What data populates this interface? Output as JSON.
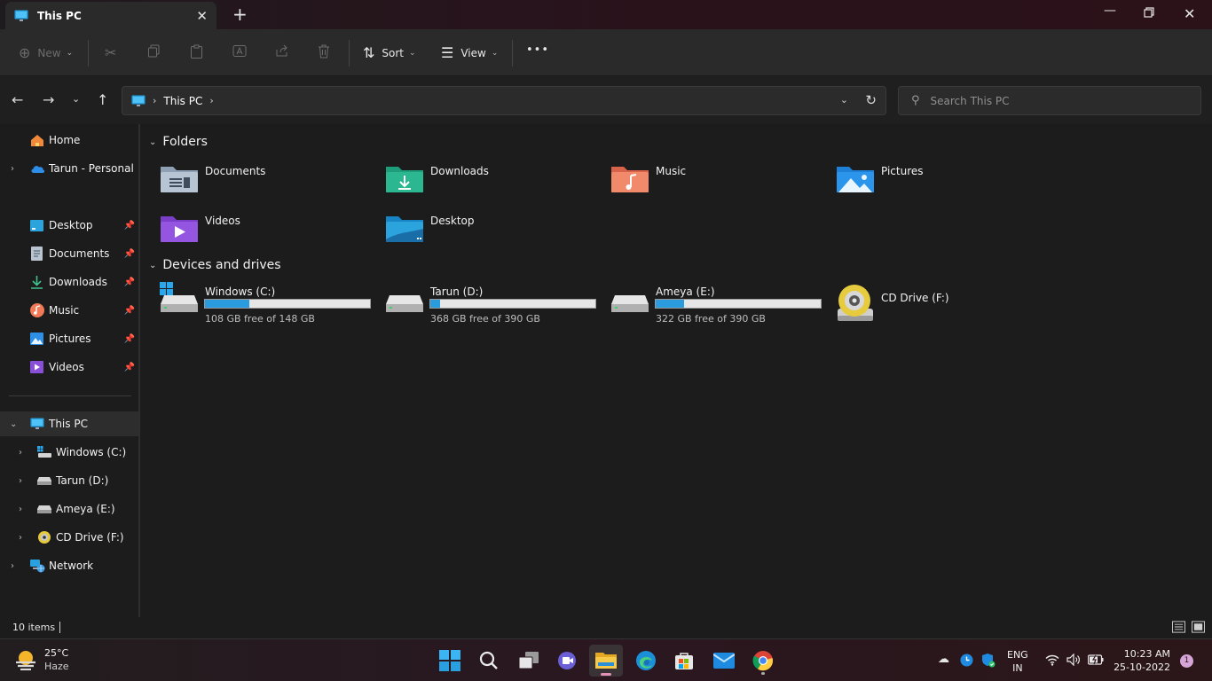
{
  "window": {
    "tab_title": "This PC",
    "colors": {
      "accent": "#2a9cde",
      "background": "#1c1c1c",
      "toolbar": "#2a2a2a"
    }
  },
  "toolbar": {
    "new_label": "New",
    "sort_label": "Sort",
    "view_label": "View",
    "more_label": "•••"
  },
  "address": {
    "crumbs": [
      "This PC"
    ],
    "search_placeholder": "Search This PC"
  },
  "sidebar": {
    "items": [
      {
        "label": "Home",
        "icon": "home-icon"
      },
      {
        "label": "Tarun - Personal",
        "icon": "onedrive-cloud-icon"
      },
      {
        "label": "Desktop",
        "icon": "desktop-icon",
        "pinned": true
      },
      {
        "label": "Documents",
        "icon": "documents-icon",
        "pinned": true
      },
      {
        "label": "Downloads",
        "icon": "downloads-icon",
        "pinned": true
      },
      {
        "label": "Music",
        "icon": "music-icon",
        "pinned": true
      },
      {
        "label": "Pictures",
        "icon": "pictures-icon",
        "pinned": true
      },
      {
        "label": "Videos",
        "icon": "videos-icon",
        "pinned": true
      },
      {
        "label": "This PC",
        "icon": "computer-icon",
        "selected": true
      },
      {
        "label": "Windows (C:)",
        "icon": "windows-drive-icon"
      },
      {
        "label": "Tarun (D:)",
        "icon": "hard-drive-icon"
      },
      {
        "label": "Ameya (E:)",
        "icon": "hard-drive-icon"
      },
      {
        "label": "CD Drive (F:)",
        "icon": "cd-drive-icon"
      },
      {
        "label": "Network",
        "icon": "network-icon"
      }
    ]
  },
  "main": {
    "folders_heading": "Folders",
    "folders": [
      {
        "name": "Documents",
        "icon": "documents-folder-icon"
      },
      {
        "name": "Downloads",
        "icon": "downloads-folder-icon"
      },
      {
        "name": "Music",
        "icon": "music-folder-icon"
      },
      {
        "name": "Pictures",
        "icon": "pictures-folder-icon"
      },
      {
        "name": "Videos",
        "icon": "videos-folder-icon"
      },
      {
        "name": "Desktop",
        "icon": "desktop-folder-icon"
      }
    ],
    "drives_heading": "Devices and drives",
    "drives": [
      {
        "name": "Windows (C:)",
        "free_text": "108 GB free of 148 GB",
        "used_fraction": 0.27
      },
      {
        "name": "Tarun (D:)",
        "free_text": "368 GB free of 390 GB",
        "used_fraction": 0.06
      },
      {
        "name": "Ameya (E:)",
        "free_text": "322 GB free of 390 GB",
        "used_fraction": 0.17
      },
      {
        "name": "CD Drive (F:)"
      }
    ]
  },
  "status": {
    "item_count": "10 items"
  },
  "taskbar": {
    "weather_temp": "25°C",
    "weather_cond": "Haze",
    "lang_line1": "ENG",
    "lang_line2": "IN",
    "time": "10:23 AM",
    "date": "25-10-2022",
    "notification_count": "1"
  }
}
